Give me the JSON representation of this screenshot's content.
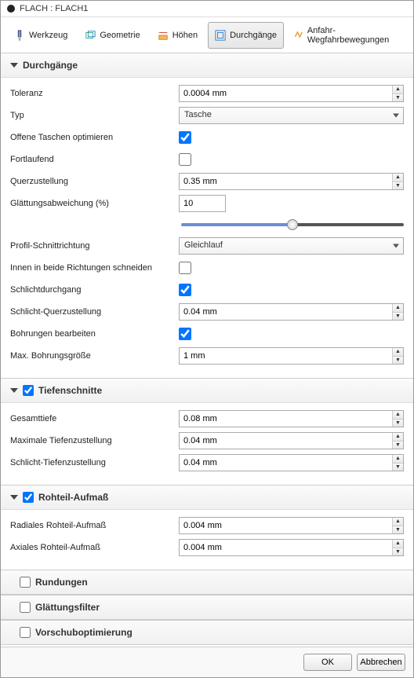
{
  "title": "FLACH : FLACH1",
  "tabs": {
    "werkzeug": "Werkzeug",
    "geometrie": "Geometrie",
    "hoehen": "Höhen",
    "durchgaenge": "Durchgänge",
    "anfahr": "Anfahr-Wegfahrbewegungen"
  },
  "sections": {
    "durchgaenge": {
      "title": "Durchgänge",
      "toleranz_label": "Toleranz",
      "toleranz_value": "0.0004 mm",
      "typ_label": "Typ",
      "typ_value": "Tasche",
      "offene_label": "Offene Taschen optimieren",
      "fortlaufend_label": "Fortlaufend",
      "querzust_label": "Querzustellung",
      "querzust_value": "0.35 mm",
      "glatt_label": "Glättungsabweichung (%)",
      "glatt_value": "10",
      "profil_label": "Profil-Schnittrichtung",
      "profil_value": "Gleichlauf",
      "innen_label": "Innen in beide Richtungen schneiden",
      "schlicht_label": "Schlichtdurchgang",
      "schlichtq_label": "Schlicht-Querzustellung",
      "schlichtq_value": "0.04 mm",
      "bohr_label": "Bohrungen bearbeiten",
      "maxbohr_label": "Max. Bohrungsgröße",
      "maxbohr_value": "1 mm"
    },
    "tiefenschnitte": {
      "title": "Tiefenschnitte",
      "gesamt_label": "Gesamttiefe",
      "gesamt_value": "0.08 mm",
      "maxtief_label": "Maximale Tiefenzustellung",
      "maxtief_value": "0.04 mm",
      "schlichtt_label": "Schlicht-Tiefenzustellung",
      "schlichtt_value": "0.04 mm"
    },
    "rohteil": {
      "title": "Rohteil-Aufmaß",
      "radial_label": "Radiales Rohteil-Aufmaß",
      "radial_value": "0.004 mm",
      "axial_label": "Axiales Rohteil-Aufmaß",
      "axial_value": "0.004 mm"
    },
    "rundungen": {
      "title": "Rundungen"
    },
    "glattfilter": {
      "title": "Glättungsfilter"
    },
    "vorschub": {
      "title": "Vorschuboptimierung"
    }
  },
  "footer": {
    "ok": "OK",
    "cancel": "Abbrechen"
  }
}
